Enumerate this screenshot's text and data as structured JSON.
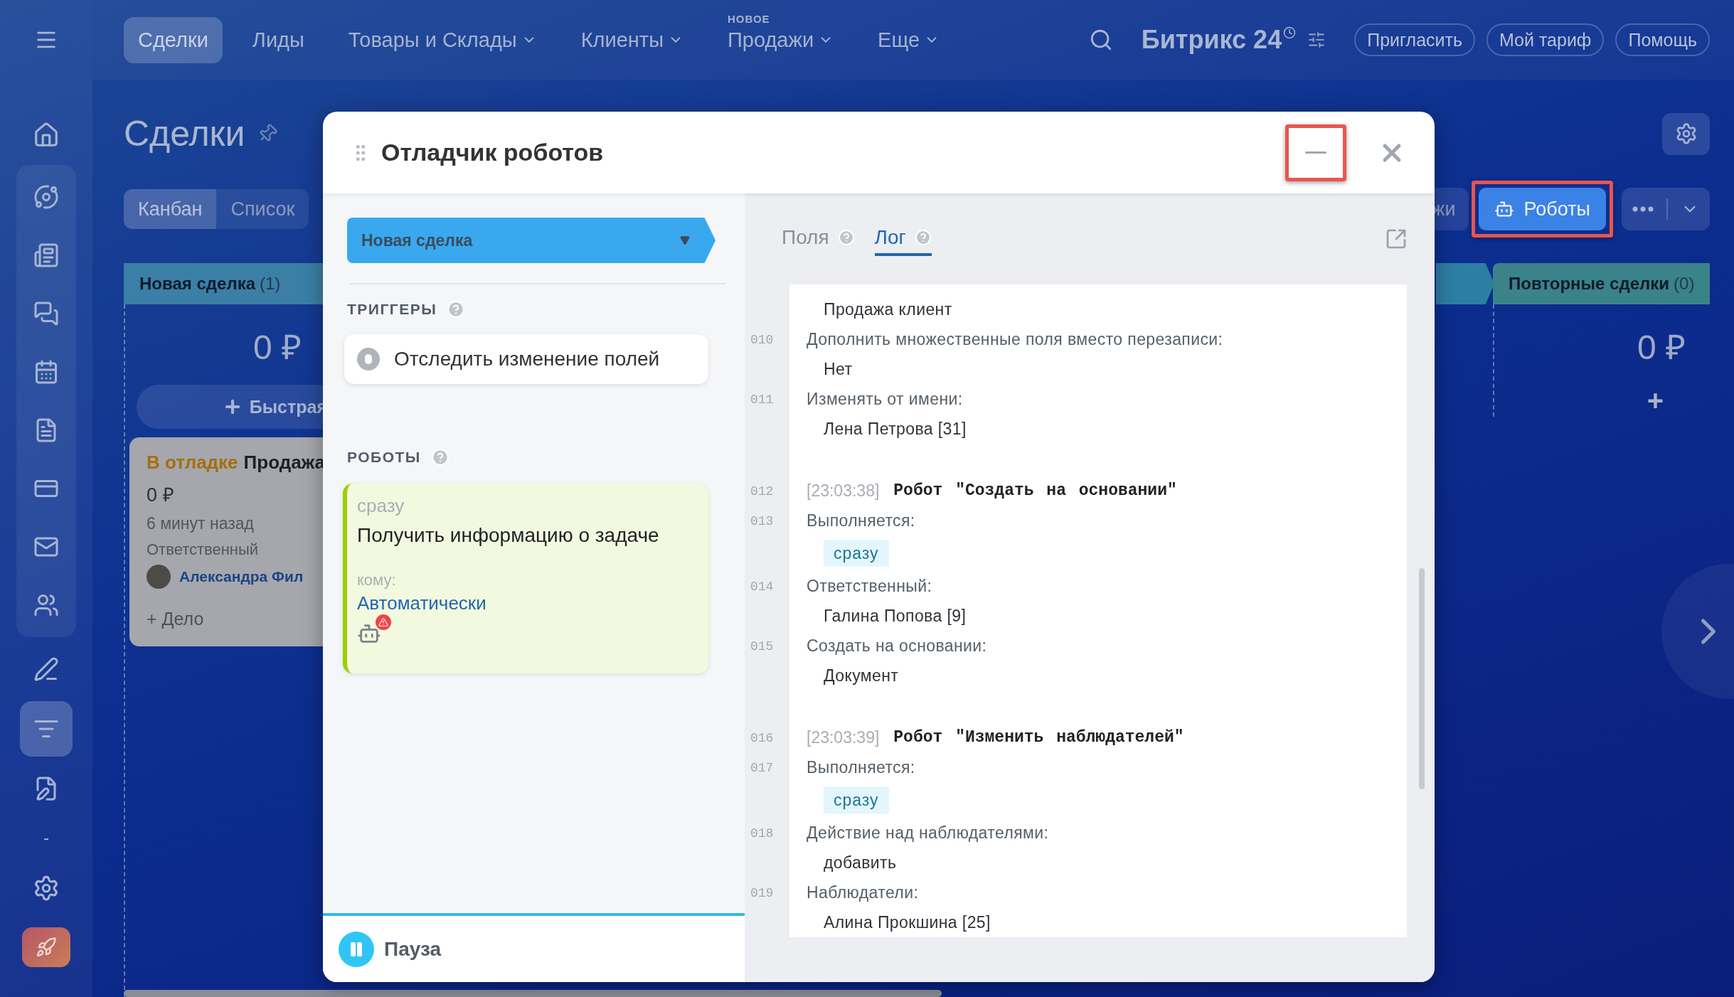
{
  "top_nav": {
    "items": [
      {
        "label": "Сделки",
        "selected": true,
        "dropdown": false
      },
      {
        "label": "Лиды",
        "selected": false,
        "dropdown": false
      },
      {
        "label": "Товары и Склады",
        "selected": false,
        "dropdown": true
      },
      {
        "label": "Клиенты",
        "selected": false,
        "dropdown": true
      },
      {
        "label": "Продажи",
        "selected": false,
        "dropdown": true,
        "badge": "НОВОЕ"
      },
      {
        "label": "Еще",
        "selected": false,
        "dropdown": true
      }
    ],
    "brand": "Битрикс 24",
    "buttons": [
      "Пригласить",
      "Мой тариф",
      "Помощь"
    ]
  },
  "sidebar": {
    "home": {
      "selected": false
    },
    "group": [
      {
        "selected": false
      },
      {
        "selected": false
      },
      {
        "selected": false
      },
      {
        "selected": false
      },
      {
        "selected": false
      },
      {
        "selected": false
      },
      {
        "selected": false
      },
      {
        "selected": false
      }
    ],
    "tools": [
      {
        "selected": false
      },
      {
        "selected": true
      },
      {
        "selected": false
      }
    ],
    "dash": "-",
    "bottom": [
      {
        "selected": false
      },
      {
        "selected": false
      }
    ]
  },
  "page": {
    "title": "Сделки",
    "view_tabs": [
      {
        "label": "Канбан",
        "selected": true
      },
      {
        "label": "Список",
        "selected": false
      }
    ],
    "partial_button": "жи",
    "robots_button": {
      "label": "Роботы",
      "highlighted": true
    },
    "left_column": {
      "title": "Новая сделка",
      "count": "(1)",
      "color": "#3b7fa6",
      "total": "0 ₽",
      "quick_add": "Быстрая",
      "card": {
        "status": "В отладке",
        "title": "Продажа",
        "amount": "0 ₽",
        "time": "6 минут назад",
        "responsible_label": "Ответственный",
        "responsible": "Александра Фил",
        "add_activity": "+ Дело"
      }
    },
    "right_column": {
      "title": "Повторные сделки",
      "count": "(0)",
      "color": "#3a8388",
      "total": "0 ₽",
      "add": "+"
    }
  },
  "modal": {
    "title": "Отладчик роботов",
    "minimize_highlighted": true,
    "stage": "Новая сделка",
    "triggers_label": "ТРИГГЕРЫ",
    "triggers": [
      {
        "label": "Отследить изменение полей"
      }
    ],
    "robots_label": "РОБОТЫ",
    "robots": [
      {
        "timing": "сразу",
        "title": "Получить информацию о задаче",
        "to_label": "кому:",
        "to": "Автоматически",
        "warning": true
      }
    ],
    "pause": "Пауза",
    "tabs": [
      {
        "label": "Поля",
        "selected": false
      },
      {
        "label": "Лог",
        "selected": true
      }
    ],
    "log": [
      {
        "kind": "value",
        "text": "Продажа клиент"
      },
      {
        "kind": "field",
        "num": "010",
        "text": "Дополнить множественные поля вместо перезаписи:"
      },
      {
        "kind": "value",
        "text": "Нет"
      },
      {
        "kind": "field",
        "num": "011",
        "text": "Изменять от имени:"
      },
      {
        "kind": "value",
        "text": "Лена Петрова [31]"
      },
      {
        "kind": "header",
        "num": "012",
        "time": "[23:03:38]",
        "text": "Робот \"Создать на основании\""
      },
      {
        "kind": "field",
        "num": "013",
        "text": "Выполняется:"
      },
      {
        "kind": "tag",
        "text": "сразу"
      },
      {
        "kind": "field",
        "num": "014",
        "text": "Ответственный:"
      },
      {
        "kind": "value",
        "text": "Галина Попова [9]"
      },
      {
        "kind": "field",
        "num": "015",
        "text": "Создать на основании:"
      },
      {
        "kind": "value",
        "text": "Документ"
      },
      {
        "kind": "header",
        "num": "016",
        "time": "[23:03:39]",
        "text": "Робот \"Изменить наблюдателей\""
      },
      {
        "kind": "field",
        "num": "017",
        "text": "Выполняется:"
      },
      {
        "kind": "tag",
        "text": "сразу"
      },
      {
        "kind": "field",
        "num": "018",
        "text": "Действие над наблюдателями:"
      },
      {
        "kind": "value",
        "text": "добавить"
      },
      {
        "kind": "field",
        "num": "019",
        "text": "Наблюдатели:"
      },
      {
        "kind": "value",
        "text": "Алина Прокшина [25]"
      }
    ]
  }
}
